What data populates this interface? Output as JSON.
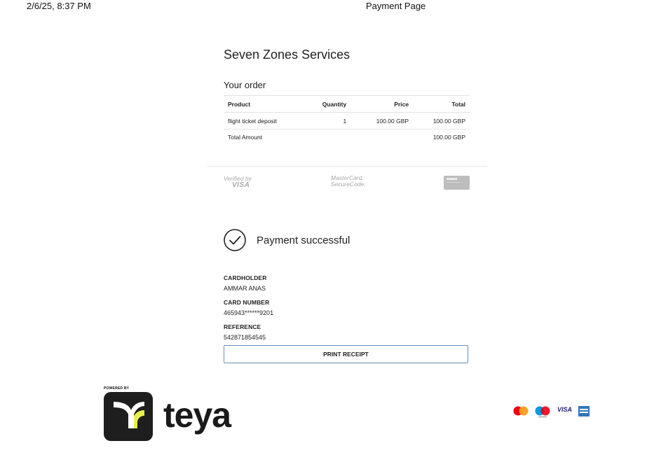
{
  "header": {
    "datetime": "2/6/25, 8:37 PM",
    "page_title": "Payment Page"
  },
  "merchant": {
    "name": "Seven Zones Services"
  },
  "order": {
    "heading": "Your order",
    "columns": {
      "product": "Product",
      "quantity": "Quantity",
      "price": "Price",
      "total": "Total"
    },
    "rows": [
      {
        "product": "flight ticket deposit",
        "quantity": "1",
        "price": "100.00 GBP",
        "total": "100.00 GBP"
      }
    ],
    "total_label": "Total Amount",
    "total_value": "100.00 GBP"
  },
  "security_badges": {
    "visa_line1": "Verified by",
    "visa_line2": "VISA",
    "mc_line1": "MasterCard.",
    "mc_line2": "SecureCode.",
    "secure_icon": "secure-payment-badge-icon"
  },
  "status": {
    "icon": "check-circle-icon",
    "message": "Payment successful"
  },
  "details": {
    "cardholder_label": "CARDHOLDER",
    "cardholder_value": "AMMAR ANAS",
    "card_number_label": "CARD NUMBER",
    "card_number_value": "465943******9201",
    "reference_label": "REFERENCE",
    "reference_value": "542871854545"
  },
  "actions": {
    "print_receipt": "PRINT RECEIPT"
  },
  "footer": {
    "powered_by": "POWERED BY",
    "brand": "teya",
    "card_icons": [
      "mastercard-icon",
      "maestro-icon",
      "visa-icon",
      "amex-icon"
    ],
    "visa_text": "VISA"
  },
  "colors": {
    "button_border": "#6b8db7",
    "teya_icon_bg": "#1e1e1e",
    "teya_icon_accent": "#e6f04a",
    "mastercard_red": "#eb001b",
    "mastercard_orange": "#f79e1b",
    "maestro_blue": "#0099df",
    "visa_blue": "#1a1f71",
    "amex_blue": "#2e77bc"
  }
}
